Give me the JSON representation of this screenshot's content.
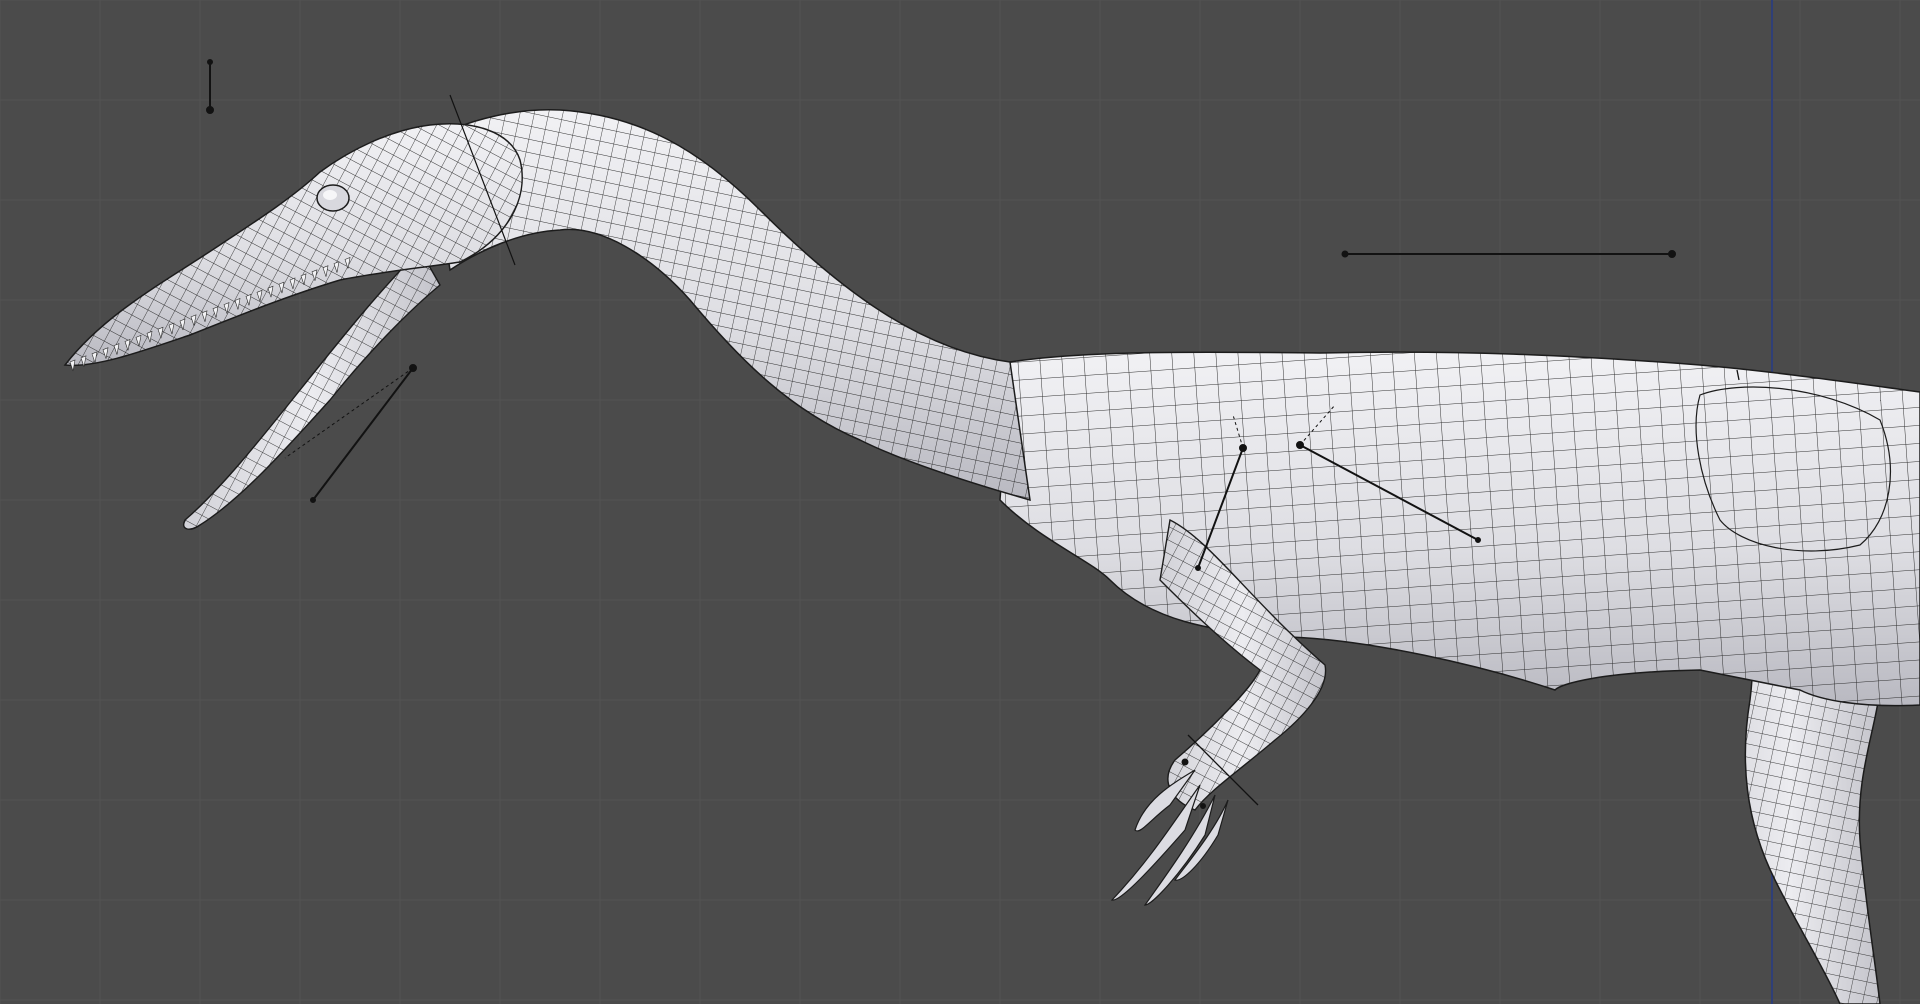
{
  "app": {
    "view": "3D viewport",
    "mode": "wireframe-overlay"
  },
  "colors": {
    "background": "#4b4b4b",
    "grid": "#535353",
    "axis": "#2f3f77",
    "mesh_fill": "#e4e4e8",
    "mesh_shadow": "#bdbdc4",
    "wire": "#1c1c1c",
    "bone": "#121212"
  },
  "icons": [
    "dinosaur-model",
    "armature-bone"
  ]
}
